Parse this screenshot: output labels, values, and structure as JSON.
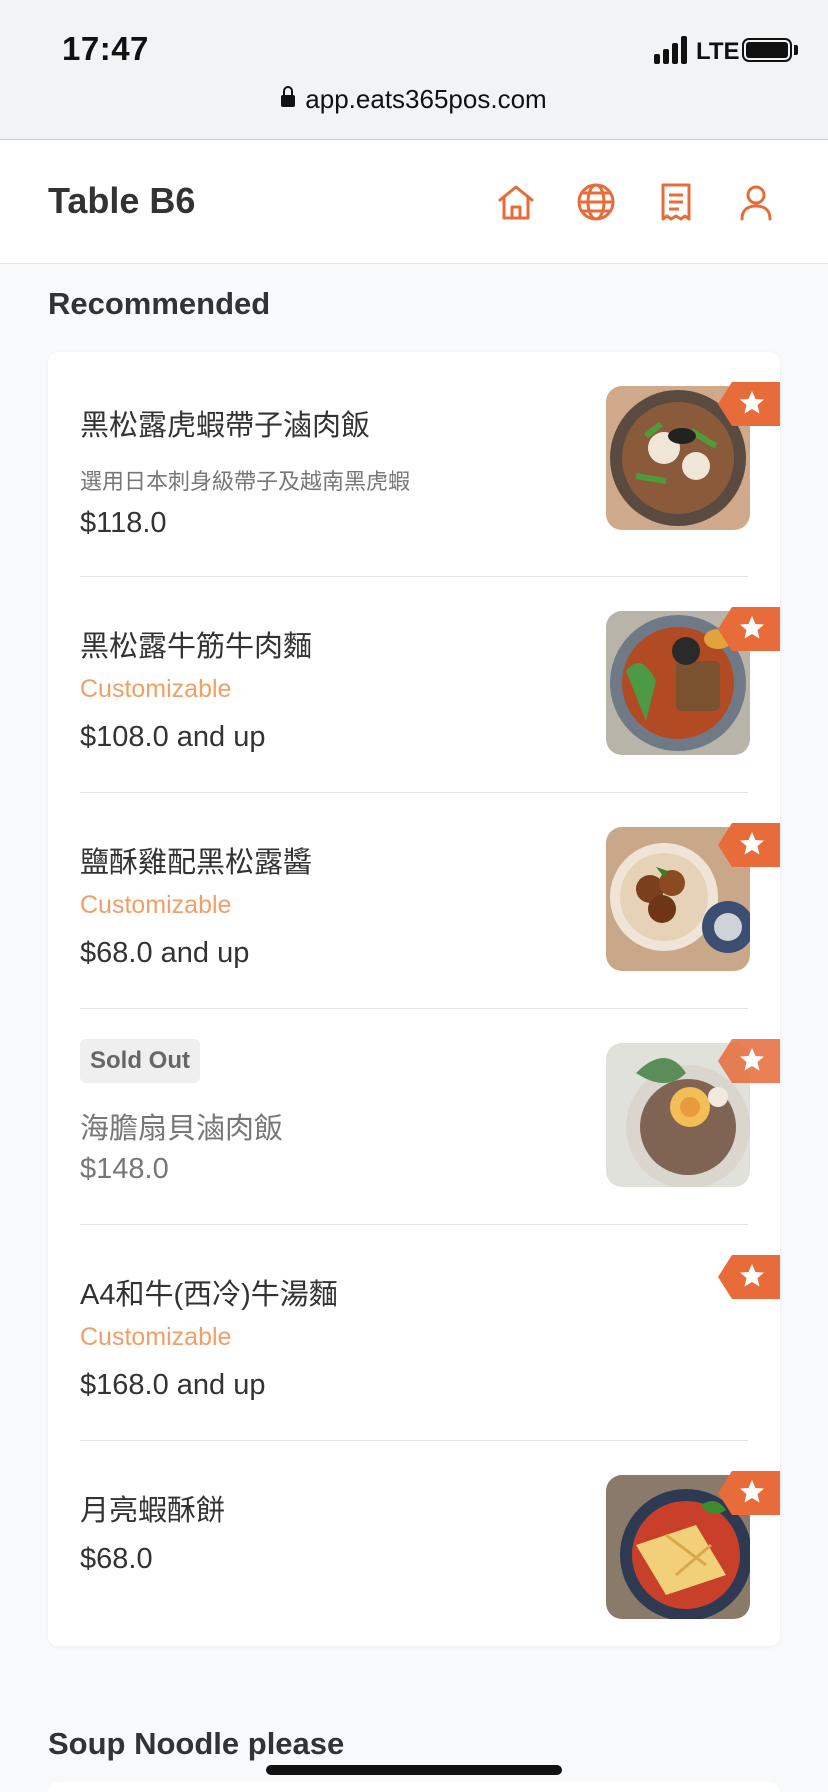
{
  "status_bar": {
    "time": "17:47",
    "network": "LTE"
  },
  "browser": {
    "url": "app.eats365pos.com"
  },
  "header": {
    "title": "Table B6",
    "icons": [
      "home-icon",
      "globe-icon",
      "receipt-icon",
      "user-icon"
    ]
  },
  "colors": {
    "accent": "#e86b3a",
    "customizable": "#f0a066"
  },
  "recommended": {
    "title": "Recommended",
    "items": [
      {
        "name": "黑松露虎蝦帶子滷肉飯",
        "description": "選用日本刺身級帶子及越南黑虎蝦",
        "price": "$118.0",
        "has_photo": true,
        "favorite": true
      },
      {
        "name": "黑松露牛筋牛肉麵",
        "tag": "Customizable",
        "price": "$108.0 and up",
        "has_photo": true,
        "favorite": true
      },
      {
        "name": "鹽酥雞配黑松露醬",
        "tag": "Customizable",
        "price": "$68.0 and up",
        "has_photo": true,
        "favorite": true
      },
      {
        "status": "Sold Out",
        "name": "海膽扇貝滷肉飯",
        "price": "$148.0",
        "has_photo": true,
        "favorite": true
      },
      {
        "name": "A4和牛(西冷)牛湯麵",
        "tag": "Customizable",
        "price": "$168.0 and up",
        "has_photo": false,
        "favorite": true
      },
      {
        "name": "月亮蝦酥餅",
        "price": "$68.0",
        "has_photo": true,
        "favorite": true
      }
    ]
  },
  "next_section": {
    "title": "Soup Noodle please"
  }
}
